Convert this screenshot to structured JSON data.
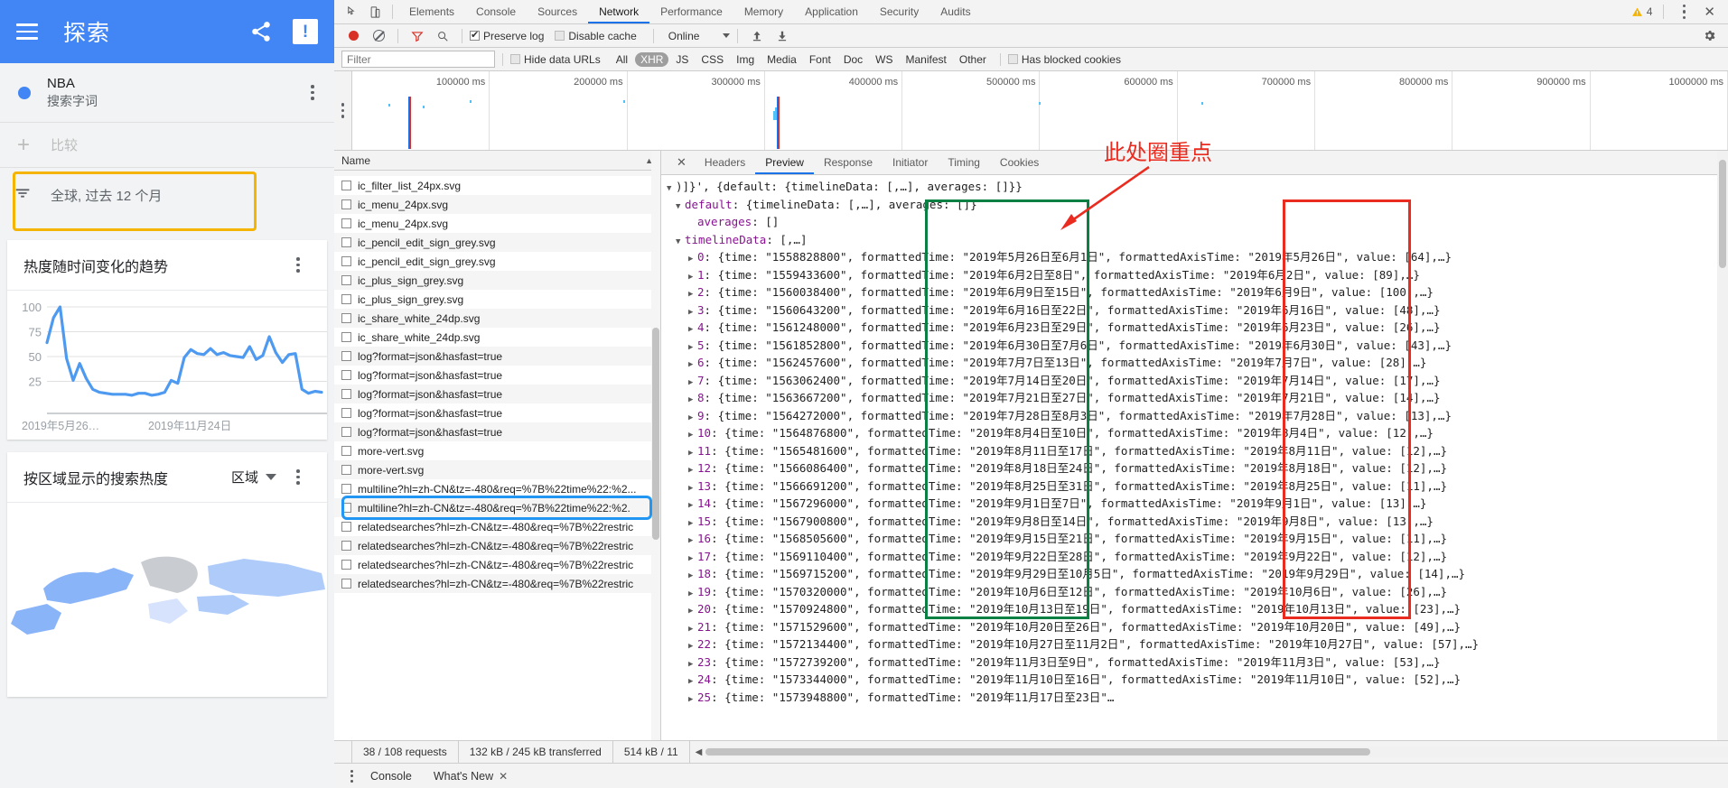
{
  "trends": {
    "appbar": {
      "title": "探索",
      "hamburger_icon": "menu-icon",
      "share_icon": "share-icon",
      "feedback_icon": "feedback-icon",
      "bg": "#4285f4"
    },
    "term": {
      "name": "NBA",
      "subtitle": "搜索字词",
      "dot_color": "#4285f4"
    },
    "compare": {
      "plus": "+",
      "label": "比较"
    },
    "filter": {
      "label": "全球, 过去 12 个月",
      "highlight_color": "#f5b400"
    },
    "trend_card": {
      "title": "热度随时间变化的趋势"
    },
    "region_card": {
      "title": "按区域显示的搜索热度",
      "selector": "区域"
    }
  },
  "chart_data": {
    "type": "line",
    "title": "热度随时间变化的趋势",
    "xlabel": "",
    "ylabel": "",
    "ylim": [
      0,
      100
    ],
    "yticks": [
      25,
      50,
      75,
      100
    ],
    "xticks": [
      "2019年5月26…",
      "2019年11月24日"
    ],
    "grid": true,
    "line_color": "#4e9af1",
    "x": [
      "2019年5月26日至6月1日",
      "2019年6月2日至8日",
      "2019年6月9日至15日",
      "2019年6月16日至22日",
      "2019年6月23日至29日",
      "2019年6月30日至7月6日",
      "2019年7月7日至13日",
      "2019年7月14日至20日",
      "2019年7月21日至27日",
      "2019年7月28日至8月3日",
      "2019年8月4日至10日",
      "2019年8月11日至17日",
      "2019年8月18日至24日",
      "2019年8月25日至31日",
      "2019年9月1日至7日",
      "2019年9月8日至14日",
      "2019年9月15日至21日",
      "2019年9月22日至28日",
      "2019年9月29日至10月5日",
      "2019年10月6日至12日",
      "2019年10月13日至19日",
      "2019年10月20日至26日",
      "2019年10月27日至11月2日",
      "2019年11月3日至9日",
      "2019年11月10日至16日"
    ],
    "values": [
      64,
      89,
      100,
      48,
      26,
      43,
      28,
      17,
      14,
      13,
      12,
      12,
      12,
      11,
      13,
      13,
      11,
      12,
      14,
      26,
      23,
      49,
      57,
      53,
      52
    ],
    "values_tail": [
      58,
      52,
      54,
      51,
      50,
      49,
      60,
      47,
      51,
      70,
      54,
      44,
      52,
      53,
      17,
      13,
      15,
      14
    ],
    "series_note": "single series"
  },
  "devtools": {
    "tabs": [
      "Elements",
      "Console",
      "Sources",
      "Network",
      "Performance",
      "Memory",
      "Application",
      "Security",
      "Audits"
    ],
    "active_tab": "Network",
    "inspect_icon": "inspect-cursor-icon",
    "device_icon": "device-toolbar-icon",
    "warning_count": "4",
    "warning_icon": "warning-triangle-icon",
    "more_icon": "kebab-menu-icon",
    "close_icon": "close-icon",
    "toolbar": {
      "record_icon": "record-circle-icon",
      "clear_icon": "clear-icon",
      "filter_icon": "funnel-icon",
      "search_icon": "search-icon",
      "preserve_log": {
        "label": "Preserve log",
        "checked": true
      },
      "disable_cache": {
        "label": "Disable cache",
        "checked": false
      },
      "throttle": "Online",
      "import_icon": "upload-arrow-icon",
      "export_icon": "download-arrow-icon",
      "settings_icon": "gear-icon"
    },
    "filterbar": {
      "placeholder": "Filter",
      "value": "",
      "hide_data_urls": {
        "label": "Hide data URLs",
        "checked": false
      },
      "types": [
        "All",
        "XHR",
        "JS",
        "CSS",
        "Img",
        "Media",
        "Font",
        "Doc",
        "WS",
        "Manifest",
        "Other"
      ],
      "selected_type": "XHR",
      "has_blocked_cookies": {
        "label": "Has blocked cookies",
        "checked": false
      }
    },
    "overview_ticks": [
      "100000 ms",
      "200000 ms",
      "300000 ms",
      "400000 ms",
      "500000 ms",
      "600000 ms",
      "700000 ms",
      "800000 ms",
      "900000 ms",
      "1000000 ms"
    ],
    "list_header": "Name",
    "requests": [
      "ic_filter_list_24px.svg",
      "ic_menu_24px.svg",
      "ic_menu_24px.svg",
      "ic_pencil_edit_sign_grey.svg",
      "ic_pencil_edit_sign_grey.svg",
      "ic_plus_sign_grey.svg",
      "ic_plus_sign_grey.svg",
      "ic_share_white_24dp.svg",
      "ic_share_white_24dp.svg",
      "log?format=json&hasfast=true",
      "log?format=json&hasfast=true",
      "log?format=json&hasfast=true",
      "log?format=json&hasfast=true",
      "log?format=json&hasfast=true",
      "more-vert.svg",
      "more-vert.svg",
      "multiline?hl=zh-CN&tz=-480&req=%7B%22time%22:%2...",
      "multiline?hl=zh-CN&tz=-480&req=%7B%22time%22:%2.",
      "relatedsearches?hl=zh-CN&tz=-480&req=%7B%22restric",
      "relatedsearches?hl=zh-CN&tz=-480&req=%7B%22restric",
      "relatedsearches?hl=zh-CN&tz=-480&req=%7B%22restric",
      "relatedsearches?hl=zh-CN&tz=-480&req=%7B%22restric"
    ],
    "selected_request_index": 17,
    "detail_tabs": [
      "Headers",
      "Preview",
      "Response",
      "Initiator",
      "Timing",
      "Cookies"
    ],
    "detail_active": "Preview",
    "preview": {
      "root": ")]}', {default: {timelineData: [,…], averages: []}}",
      "level1": "default: {timelineData: [,…], averages: []}",
      "averages": "averages: []",
      "timeline": "timelineData: [,…]",
      "rows": [
        {
          "i": "0",
          "time": "1558828800",
          "ft": "\"2019年5月26日至6月1日\"",
          "fat": "\"2019年5月26日\"",
          "value": "[64],…}"
        },
        {
          "i": "1",
          "time": "1559433600",
          "ft": "\"2019年6月2日至8日\"",
          "fat": "\"2019年6月2日\"",
          "value": "[89],…}"
        },
        {
          "i": "2",
          "time": "1560038400",
          "ft": "\"2019年6月9日至15日\"",
          "fat": "\"2019年6月9日\"",
          "value": "[100],…}"
        },
        {
          "i": "3",
          "time": "1560643200",
          "ft": "\"2019年6月16日至22日\"",
          "fat": "\"2019年6月16日\"",
          "value": "[48],…}"
        },
        {
          "i": "4",
          "time": "1561248000",
          "ft": "\"2019年6月23日至29日\"",
          "fat": "\"2019年6月23日\"",
          "value": "[26],…}"
        },
        {
          "i": "5",
          "time": "1561852800",
          "ft": "\"2019年6月30日至7月6日\"",
          "fat": "\"2019年6月30日\"",
          "value": "[43],…}"
        },
        {
          "i": "6",
          "time": "1562457600",
          "ft": "\"2019年7月7日至13日\"",
          "fat": "\"2019年7月7日\"",
          "value": "[28],…}"
        },
        {
          "i": "7",
          "time": "1563062400",
          "ft": "\"2019年7月14日至20日\"",
          "fat": "\"2019年7月14日\"",
          "value": "[17],…}"
        },
        {
          "i": "8",
          "time": "1563667200",
          "ft": "\"2019年7月21日至27日\"",
          "fat": "\"2019年7月21日\"",
          "value": "[14],…}"
        },
        {
          "i": "9",
          "time": "1564272000",
          "ft": "\"2019年7月28日至8月3日\"",
          "fat": "\"2019年7月28日\"",
          "value": "[13],…}"
        },
        {
          "i": "10",
          "time": "1564876800",
          "ft": "\"2019年8月4日至10日\"",
          "fat": "\"2019年8月4日\"",
          "value": "[12],…}"
        },
        {
          "i": "11",
          "time": "1565481600",
          "ft": "\"2019年8月11日至17日\"",
          "fat": "\"2019年8月11日\"",
          "value": "[12],…}"
        },
        {
          "i": "12",
          "time": "1566086400",
          "ft": "\"2019年8月18日至24日\"",
          "fat": "\"2019年8月18日\"",
          "value": "[12],…}"
        },
        {
          "i": "13",
          "time": "1566691200",
          "ft": "\"2019年8月25日至31日\"",
          "fat": "\"2019年8月25日\"",
          "value": "[11],…}"
        },
        {
          "i": "14",
          "time": "1567296000",
          "ft": "\"2019年9月1日至7日\"",
          "fat": "\"2019年9月1日\"",
          "value": "[13],…}"
        },
        {
          "i": "15",
          "time": "1567900800",
          "ft": "\"2019年9月8日至14日\"",
          "fat": "\"2019年9月8日\"",
          "value": "[13],…}"
        },
        {
          "i": "16",
          "time": "1568505600",
          "ft": "\"2019年9月15日至21日\"",
          "fat": "\"2019年9月15日\"",
          "value": "[11],…}"
        },
        {
          "i": "17",
          "time": "1569110400",
          "ft": "\"2019年9月22日至28日\"",
          "fat": "\"2019年9月22日\"",
          "value": "[12],…}"
        },
        {
          "i": "18",
          "time": "1569715200",
          "ft": "\"2019年9月29日至10月5日\"",
          "fat": "\"2019年9月29日\"",
          "value": "[14],…}"
        },
        {
          "i": "19",
          "time": "1570320000",
          "ft": "\"2019年10月6日至12日\"",
          "fat": "\"2019年10月6日\"",
          "value": "[26],…}"
        },
        {
          "i": "20",
          "time": "1570924800",
          "ft": "\"2019年10月13日至19日\"",
          "fat": "\"2019年10月13日\"",
          "value": "[23],…}"
        },
        {
          "i": "21",
          "time": "1571529600",
          "ft": "\"2019年10月20日至26日\"",
          "fat": "\"2019年10月20日\"",
          "value": "[49],…}"
        },
        {
          "i": "22",
          "time": "1572134400",
          "ft": "\"2019年10月27日至11月2日\"",
          "fat": "\"2019年10月27日\"",
          "value": "[57],…}"
        },
        {
          "i": "23",
          "time": "1572739200",
          "ft": "\"2019年11月3日至9日\"",
          "fat": "\"2019年11月3日\"",
          "value": "[53],…}"
        },
        {
          "i": "24",
          "time": "1573344000",
          "ft": "\"2019年11月10日至16日\"",
          "fat": "\"2019年11月10日\"",
          "value": "[52],…}"
        }
      ],
      "prefix_time": "{time: ",
      "label_ft": ", formattedTime: ",
      "label_fat": ", formattedAxisTime: ",
      "label_value": ", value: "
    },
    "annotation": {
      "text": "此处圈重点",
      "color": "#ea2b1f",
      "green_box": "#0b8043",
      "red_box": "#ea2b1f",
      "blue_box": "#2196f3"
    },
    "status": {
      "requests": "38 / 108 requests",
      "transferred": "132 kB / 245 kB transferred",
      "resources": "514 kB / 11"
    },
    "console_drawer": {
      "tabs": [
        "Console",
        "What's New"
      ],
      "close_icon": "close-icon"
    }
  }
}
